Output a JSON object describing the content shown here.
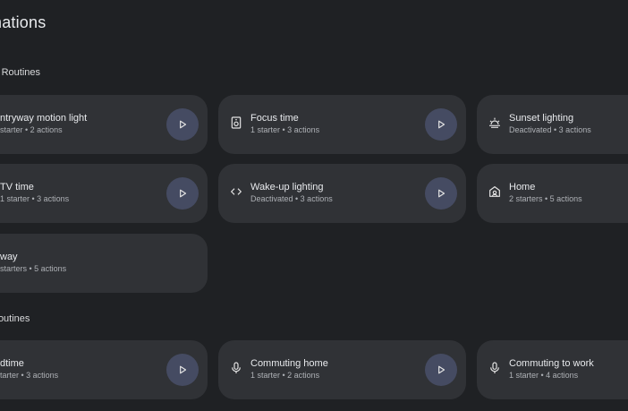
{
  "page": {
    "title": "mations"
  },
  "sections": [
    {
      "label": "ld Routines"
    },
    {
      "label": " Routines"
    }
  ],
  "cards": [
    {
      "name": "ntryway motion light",
      "meta": "starter • 2 actions",
      "icon": ""
    },
    {
      "name": "Focus time",
      "meta": "1 starter • 3 actions",
      "icon": "speaker-icon"
    },
    {
      "name": "Sunset lighting",
      "meta": "Deactivated • 3 actions",
      "icon": "sunset-icon"
    },
    {
      "name": "TV time",
      "meta": "1 starter • 3 actions",
      "icon": ""
    },
    {
      "name": "Wake-up lighting",
      "meta": "Deactivated • 3 actions",
      "icon": "code-icon"
    },
    {
      "name": "Home",
      "meta": "2 starters • 5 actions",
      "icon": "home-icon"
    },
    {
      "name": "way",
      "meta": "starters • 5 actions",
      "icon": ""
    },
    {
      "name": "dtime",
      "meta": "tarter • 3 actions",
      "icon": ""
    },
    {
      "name": "Commuting home",
      "meta": "1 starter • 2 actions",
      "icon": "mic-icon"
    },
    {
      "name": "Commuting to work",
      "meta": "1 starter • 4 actions",
      "icon": "mic-icon"
    }
  ]
}
